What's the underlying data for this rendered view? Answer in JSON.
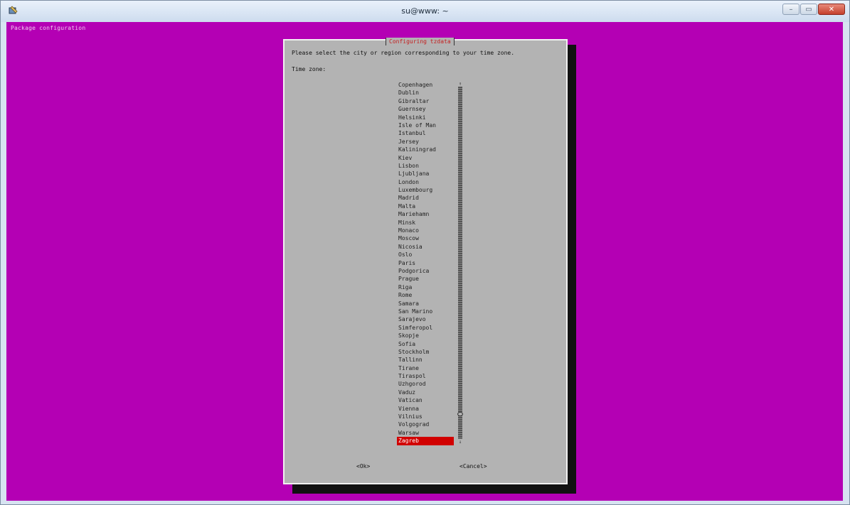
{
  "window": {
    "title": "su@www: ~",
    "colors": {
      "terminal_bg": "#b400b4",
      "dialog_bg": "#b3b3b3",
      "selection": "#d10000",
      "dialog_title": "#c42020"
    }
  },
  "terminal": {
    "backtitle": "Package configuration"
  },
  "dialog": {
    "title": "Configuring tzdata",
    "prompt": "Please select the city or region corresponding to your time zone.",
    "label": "Time zone:",
    "items": [
      "Copenhagen",
      "Dublin",
      "Gibraltar",
      "Guernsey",
      "Helsinki",
      "Isle of Man",
      "Istanbul",
      "Jersey",
      "Kaliningrad",
      "Kiev",
      "Lisbon",
      "Ljubljana",
      "London",
      "Luxembourg",
      "Madrid",
      "Malta",
      "Mariehamn",
      "Minsk",
      "Monaco",
      "Moscow",
      "Nicosia",
      "Oslo",
      "Paris",
      "Podgorica",
      "Prague",
      "Riga",
      "Rome",
      "Samara",
      "San Marino",
      "Sarajevo",
      "Simferopol",
      "Skopje",
      "Sofia",
      "Stockholm",
      "Tallinn",
      "Tirane",
      "Tiraspol",
      "Uzhgorod",
      "Vaduz",
      "Vatican",
      "Vienna",
      "Vilnius",
      "Volgograd",
      "Warsaw",
      "Zagreb"
    ],
    "selected": "Zagreb",
    "scroll_position": 0.93,
    "ok_label": "<Ok>",
    "cancel_label": "<Cancel>",
    "scroll_up_glyph": "↑",
    "scroll_down_glyph": "↓"
  }
}
